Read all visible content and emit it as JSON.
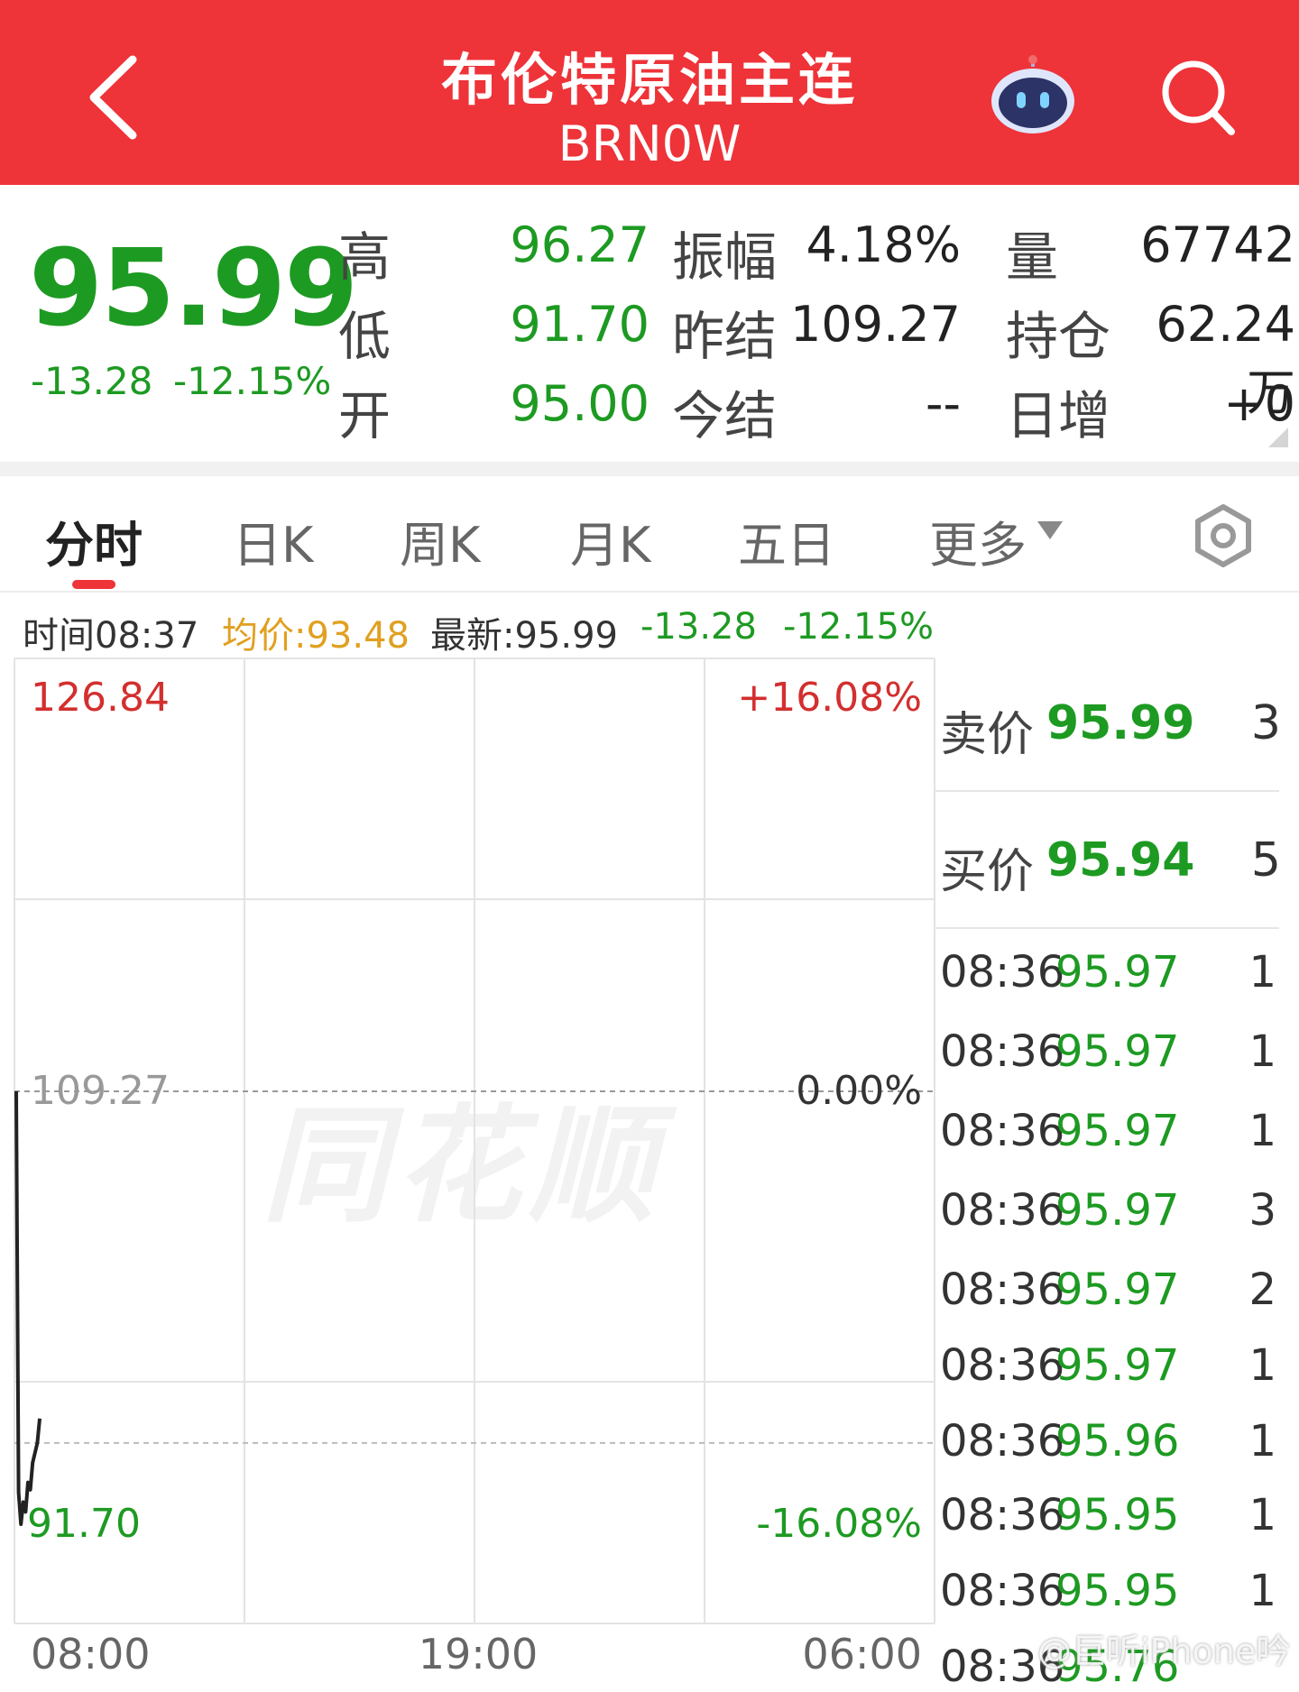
{
  "header": {
    "title": "布伦特原油主连",
    "subtitle": "BRN0W"
  },
  "quote": {
    "price": "95.99",
    "change": "-13.28",
    "change_pct": "-12.15%",
    "fields": [
      {
        "label": "高",
        "value": "96.27"
      },
      {
        "label": "低",
        "value": "91.70"
      },
      {
        "label": "开",
        "value": "95.00"
      },
      {
        "label": "振幅",
        "value": "4.18%"
      },
      {
        "label": "昨结",
        "value": "109.27"
      },
      {
        "label": "今结",
        "value": "--"
      },
      {
        "label": "量",
        "value": "67742"
      },
      {
        "label": "持仓",
        "value": "62.24万"
      },
      {
        "label": "日增",
        "value": "+0"
      }
    ]
  },
  "tabs": {
    "items": [
      "分时",
      "日K",
      "周K",
      "月K",
      "五日",
      "更多"
    ]
  },
  "info_bar": {
    "time": "时间08:37",
    "avg": "均价:93.48",
    "latest": "最新:95.99",
    "change": "-13.28",
    "change_pct": "-12.15%"
  },
  "colors": {
    "header_bg": "#ee3339",
    "up": "#d32f2f",
    "down": "#1d9a22",
    "avg": "#e0a020"
  },
  "chart_data": {
    "type": "line",
    "y_axis_left": [
      "126.84",
      "109.27",
      "91.70"
    ],
    "y_axis_right": [
      "+16.08%",
      "0.00%",
      "-16.08%"
    ],
    "x_labels": [
      "08:00",
      "19:00",
      "06:00"
    ],
    "ylim": [
      91.7,
      126.84
    ],
    "reference_price": 109.27,
    "series": [
      {
        "values": [
          109.27,
          93.0,
          91.7,
          92.6,
          92.2,
          93.4,
          93.1,
          94.2,
          94.6,
          95.0,
          95.99
        ]
      }
    ],
    "watermark": "同花顺"
  },
  "order_book": {
    "sell": {
      "label": "卖价",
      "price": "95.99",
      "qty": "3"
    },
    "buy": {
      "label": "买价",
      "price": "95.94",
      "qty": "5"
    },
    "ticks": [
      {
        "time": "08:36",
        "price": "95.97",
        "qty": "1"
      },
      {
        "time": "08:36",
        "price": "95.97",
        "qty": "1"
      },
      {
        "time": "08:36",
        "price": "95.97",
        "qty": "1"
      },
      {
        "time": "08:36",
        "price": "95.97",
        "qty": "3"
      },
      {
        "time": "08:36",
        "price": "95.97",
        "qty": "2"
      },
      {
        "time": "08:36",
        "price": "95.97",
        "qty": "1"
      },
      {
        "time": "08:36",
        "price": "95.96",
        "qty": "1"
      },
      {
        "time": "08:36",
        "price": "95.95",
        "qty": "1"
      },
      {
        "time": "08:36",
        "price": "95.95",
        "qty": "1"
      },
      {
        "time": "08:36",
        "price": "95.76",
        "qty": ""
      }
    ]
  },
  "weibo_mark": "@巨听iPhone吟",
  "icons": [
    "back-arrow-icon",
    "robot-icon",
    "search-icon",
    "settings-icon",
    "dropdown-icon"
  ]
}
